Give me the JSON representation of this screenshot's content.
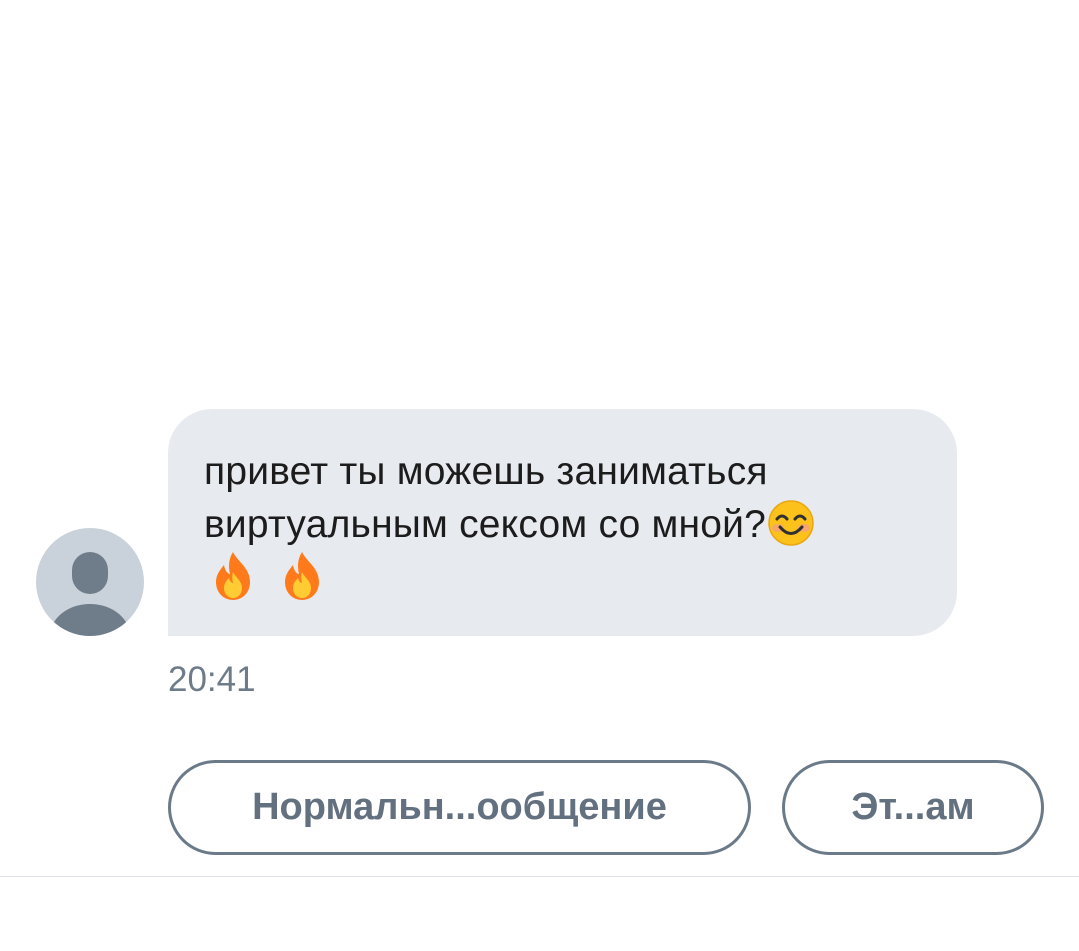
{
  "message": {
    "line1": "привет ты можешь заниматься",
    "line2": "виртуальным сексом со мной?",
    "emoji_after_line2": "smiling-face-emoji",
    "line3_emojis": [
      "fire-emoji",
      "fire-emoji"
    ],
    "time": "20:41"
  },
  "quick_replies": [
    {
      "label": "Нормальн...ообщение"
    },
    {
      "label": "Эт...ам"
    }
  ],
  "colors": {
    "bubble_bg": "#e7ebf0",
    "text": "#1c1c1c",
    "secondary_text": "#6e7b88",
    "button_border": "#6b7a89",
    "button_text": "#627080",
    "avatar_bg": "#c9d1da",
    "avatar_fg": "#6f7d8b"
  }
}
